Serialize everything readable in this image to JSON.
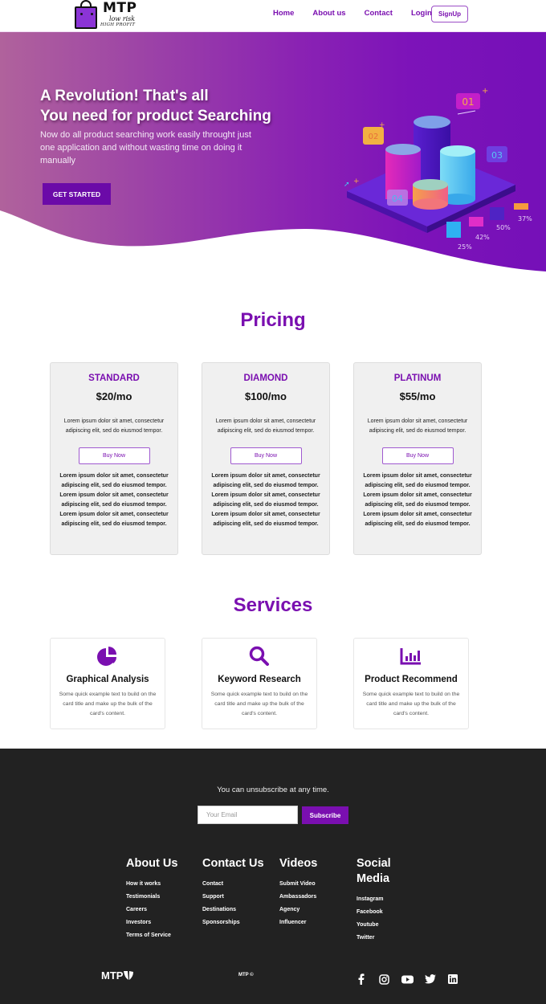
{
  "navbar": {
    "logo": {
      "brand": "MTP",
      "tagline_1": "low risk",
      "tagline_2": "HIGH PROFIT",
      "icon": "shopping-bag-icon"
    },
    "links": [
      {
        "label": "Home"
      },
      {
        "label": "About us"
      },
      {
        "label": "Contact"
      },
      {
        "label": "Login"
      }
    ],
    "signup_label": "SignUp"
  },
  "hero": {
    "title_line_1": "A Revolution! That's all",
    "title_line_2": "You need for product Searching",
    "subtitle": "Now do all product searching work easily throught just one application and without wasting time on doing it manually",
    "cta_label": "GET STARTED",
    "illustration": {
      "labels": [
        "01",
        "02",
        "03",
        "04"
      ],
      "percentages": [
        "25%",
        "42%",
        "50%",
        "37%"
      ]
    },
    "colors": {
      "gradient_start": "#b0629c",
      "gradient_end": "#7510b8"
    }
  },
  "pricing": {
    "title": "Pricing",
    "plans": [
      {
        "name": "STANDARD",
        "price": "$20/mo",
        "description": "Lorem ipsum dolor sit amet, consectetur adipiscing elit, sed do eiusmod tempor.",
        "button_label": "Buy Now",
        "features": "Lorem ipsum dolor sit amet, consectetur adipiscing elit, sed do eiusmod tempor. Lorem ipsum dolor sit amet, consectetur adipiscing elit, sed do eiusmod tempor. Lorem ipsum dolor sit amet, consectetur adipiscing elit, sed do eiusmod tempor."
      },
      {
        "name": "DIAMOND",
        "price": "$100/mo",
        "description": "Lorem ipsum dolor sit amet, consectetur adipiscing elit, sed do eiusmod tempor.",
        "button_label": "Buy Now",
        "features": "Lorem ipsum dolor sit amet, consectetur adipiscing elit, sed do eiusmod tempor. Lorem ipsum dolor sit amet, consectetur adipiscing elit, sed do eiusmod tempor. Lorem ipsum dolor sit amet, consectetur adipiscing elit, sed do eiusmod tempor."
      },
      {
        "name": "PLATINUM",
        "price": "$55/mo",
        "description": "Lorem ipsum dolor sit amet, consectetur adipiscing elit, sed do eiusmod tempor.",
        "button_label": "Buy Now",
        "features": "Lorem ipsum dolor sit amet, consectetur adipiscing elit, sed do eiusmod tempor. Lorem ipsum dolor sit amet, consectetur adipiscing elit, sed do eiusmod tempor. Lorem ipsum dolor sit amet, consectetur adipiscing elit, sed do eiusmod tempor."
      }
    ]
  },
  "services": {
    "title": "Services",
    "items": [
      {
        "icon": "pie-chart-icon",
        "title": "Graphical Analysis",
        "description": "Some quick example text to build on the card title and make up the bulk of the card's content."
      },
      {
        "icon": "search-icon",
        "title": "Keyword Research",
        "description": "Some quick example text to build on the card title and make up the bulk of the card's content."
      },
      {
        "icon": "bar-chart-icon",
        "title": "Product Recommend",
        "description": "Some quick example text to build on the card title and make up the bulk of the card's content."
      }
    ]
  },
  "footer": {
    "unsubscribe_note": "You can unsubscribe at any time.",
    "email_placeholder": "Your Email",
    "subscribe_label": "Subscribe",
    "columns": [
      {
        "title": "About Us",
        "links": [
          "How it works",
          "Testimonials",
          "Careers",
          "Investors",
          "Terms of Service"
        ]
      },
      {
        "title": "Contact Us",
        "links": [
          "Contact",
          "Support",
          "Destinations",
          "Sponsorships"
        ]
      },
      {
        "title": "Videos",
        "links": [
          "Submit Video",
          "Ambassadors",
          "Agency",
          "Influencer"
        ]
      },
      {
        "title": "Social Media",
        "links": [
          "Instagram",
          "Facebook",
          "Youtube",
          "Twitter"
        ]
      }
    ],
    "brand": "MTP",
    "copyright": "MTP ©",
    "social_icons": [
      "facebook-icon",
      "instagram-icon",
      "youtube-icon",
      "twitter-icon",
      "linkedin-icon"
    ]
  },
  "colors": {
    "accent": "#7a0fb0",
    "footer_bg": "#222222",
    "card_bg": "#f0f0f0"
  }
}
